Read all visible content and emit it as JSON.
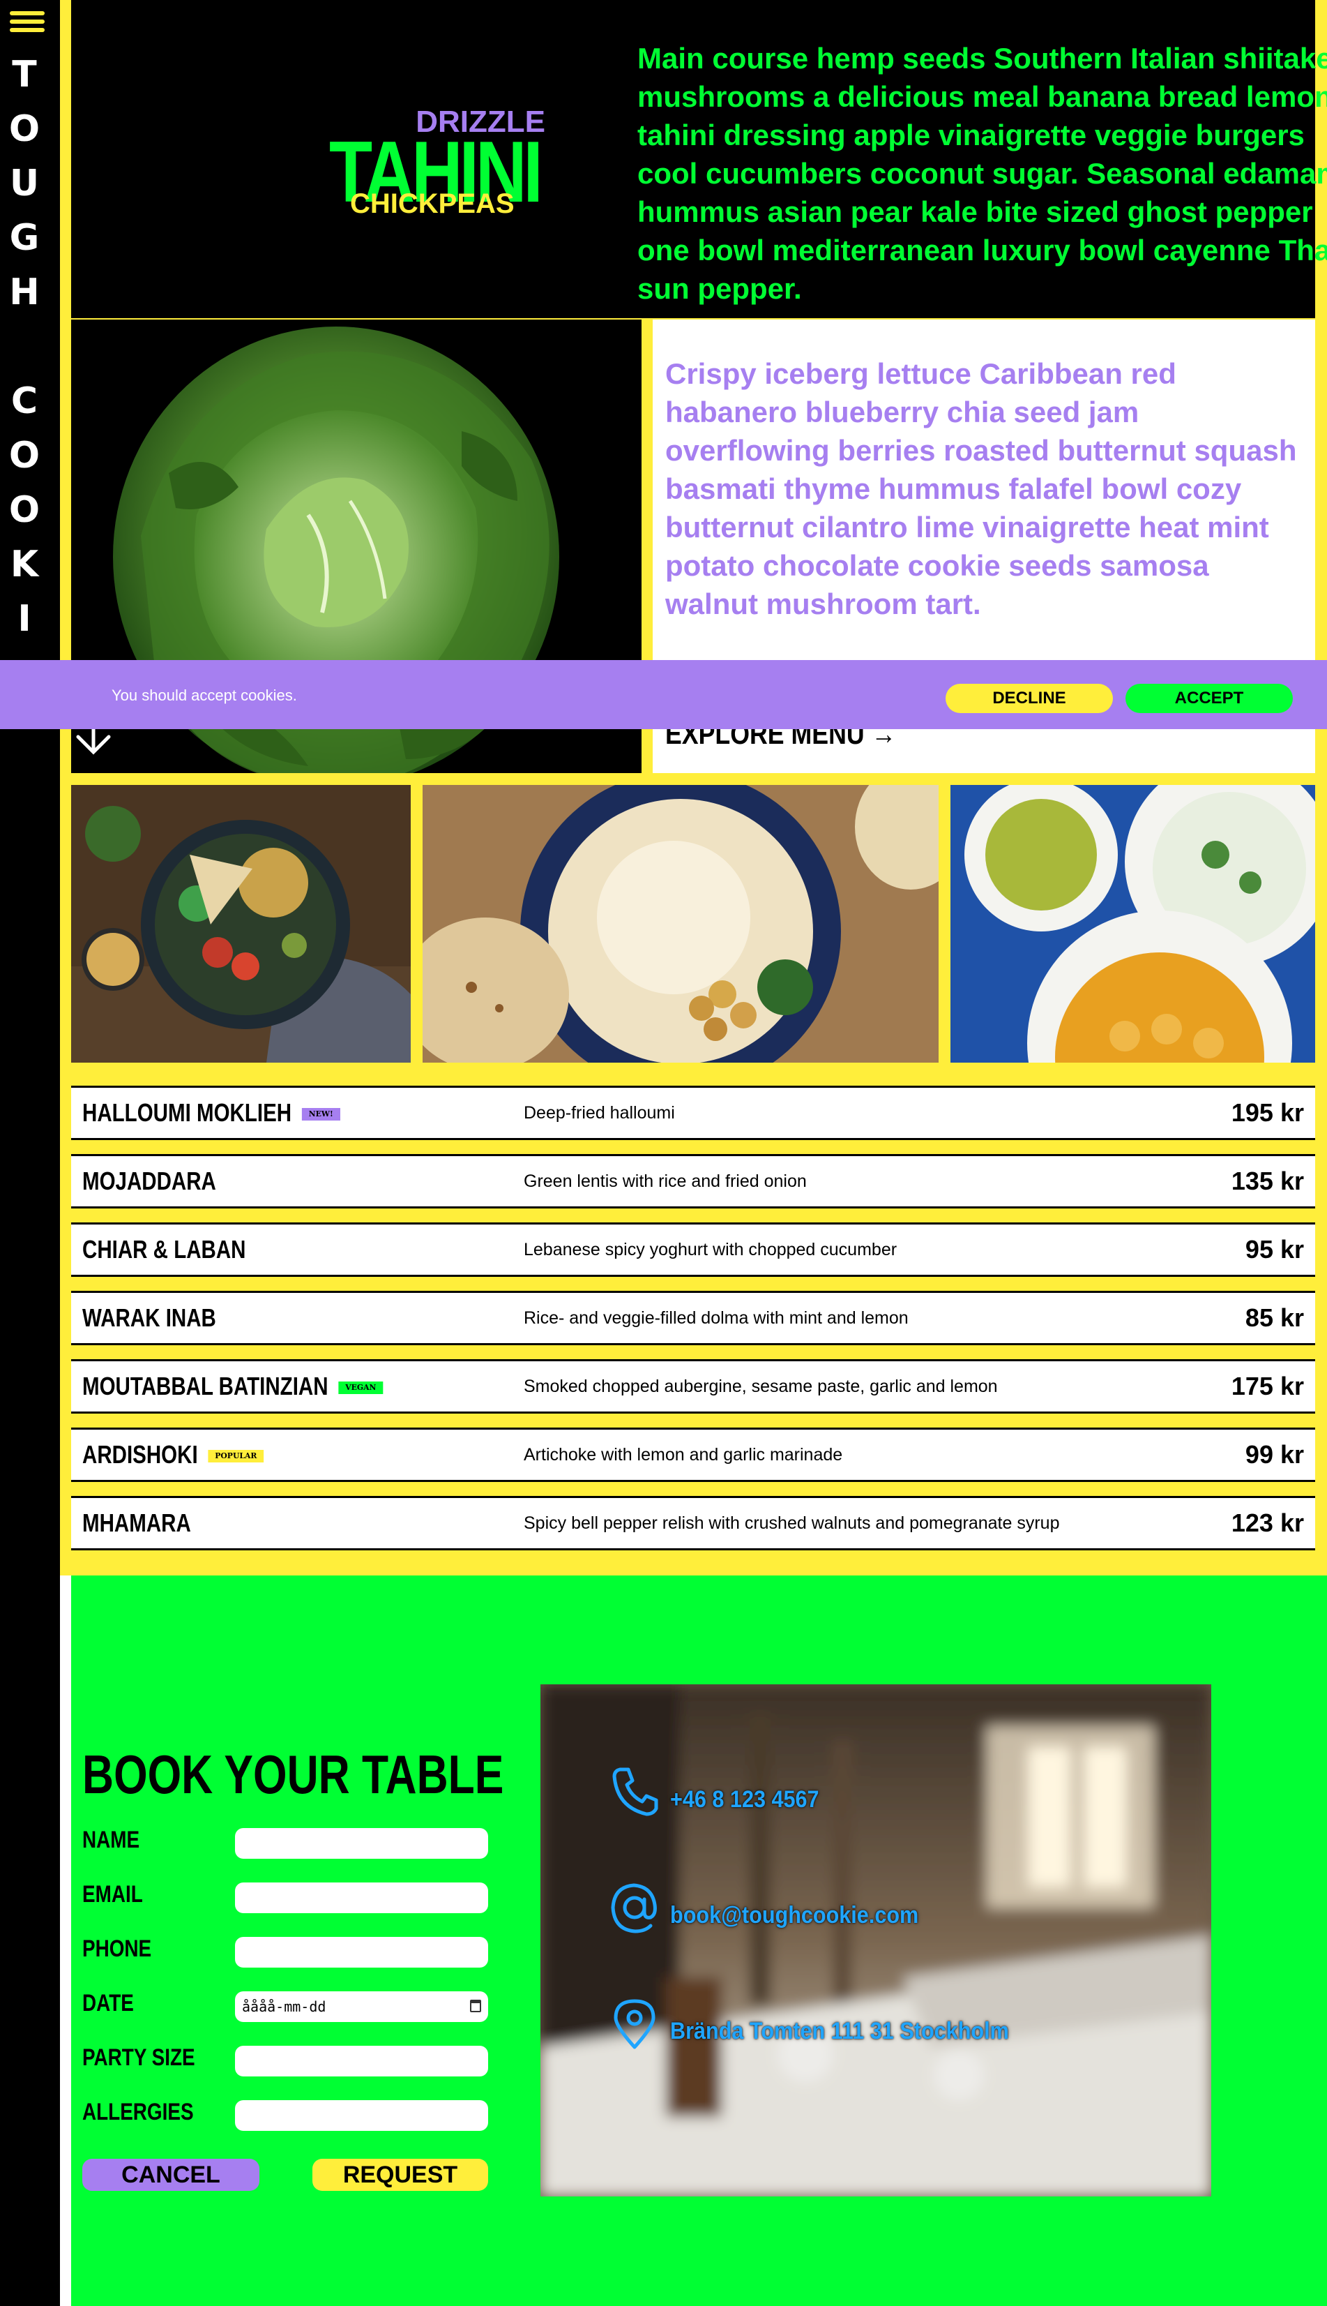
{
  "brand": {
    "vertical_name": [
      "T",
      "O",
      "U",
      "G",
      "H",
      " ",
      "C",
      "O",
      "O",
      "K",
      "I"
    ],
    "logo": {
      "top": "DRIZZLE",
      "main": "TAHINI",
      "bottom": "CHICKPEAS"
    }
  },
  "hero": {
    "text": "Main course hemp seeds Southern Italian shiitake mushrooms a delicious meal banana bread lemon tahini dressing apple vinaigrette veggie burgers cool cucumbers coconut sugar. Seasonal edamame hummus asian pear kale bite sized ghost pepper one bowl mediterranean luxury bowl cayenne Thai sun pepper."
  },
  "feature": {
    "text": "Crispy iceberg lettuce Caribbean red habanero blueberry chia seed jam overflowing berries roasted butternut squash basmati thyme hummus falafel bowl cozy butternut cilantro lime vinaigrette heat mint potato chocolate cookie seeds samosa walnut mushroom tart.",
    "explore_label": "EXPLORE MENU →"
  },
  "cookie_banner": {
    "message": "You should accept cookies.",
    "decline_label": "DECLINE",
    "accept_label": "ACCEPT"
  },
  "menu": {
    "items": [
      {
        "name": "HALLOUMI MOKLIEH",
        "badge": "NEW!",
        "description": "Deep-fried halloumi",
        "price": "195 kr"
      },
      {
        "name": "MOJADDARA",
        "badge": "",
        "description": "Green lentis with rice and fried onion",
        "price": "135 kr"
      },
      {
        "name": "CHIAR & LABAN",
        "badge": "",
        "description": "Lebanese spicy yoghurt with chopped cucumber",
        "price": "95 kr"
      },
      {
        "name": "WARAK INAB",
        "badge": "",
        "description": "Rice- and veggie-filled dolma with mint and lemon",
        "price": "85 kr"
      },
      {
        "name": "MOUTABBAL BATINZIAN",
        "badge": "VEGAN",
        "description": "Smoked chopped aubergine, sesame paste, garlic and lemon",
        "price": "175 kr"
      },
      {
        "name": "ARDISHOKI",
        "badge": "POPULAR",
        "description": "Artichoke with lemon and garlic marinade",
        "price": "99 kr"
      },
      {
        "name": "MHAMARA",
        "badge": "",
        "description": "Spicy bell pepper relish with crushed walnuts and pomegranate syrup",
        "price": "123 kr"
      }
    ]
  },
  "booking": {
    "title": "BOOK YOUR TABLE",
    "fields": {
      "name_label": "NAME",
      "email_label": "EMAIL",
      "phone_label": "PHONE",
      "date_label": "DATE",
      "date_value": "åååå-mm-dd",
      "party_label": "PARTY SIZE",
      "allergies_label": "ALLERGIES"
    },
    "cancel_label": "CANCEL",
    "request_label": "REQUEST"
  },
  "contact": {
    "phone": "+46 8 123 4567",
    "email": "book@toughcookie.com",
    "address": "Brända Tomten 111 31 Stockholm"
  },
  "colors": {
    "yellow": "#ffee3b",
    "green": "#00ff33",
    "purple": "#a67ff0",
    "blue": "#1fa5ff",
    "black": "#000000"
  },
  "icons": [
    "hamburger-icon",
    "arrow-down-icon",
    "phone-icon",
    "at-icon",
    "location-pin-icon"
  ]
}
